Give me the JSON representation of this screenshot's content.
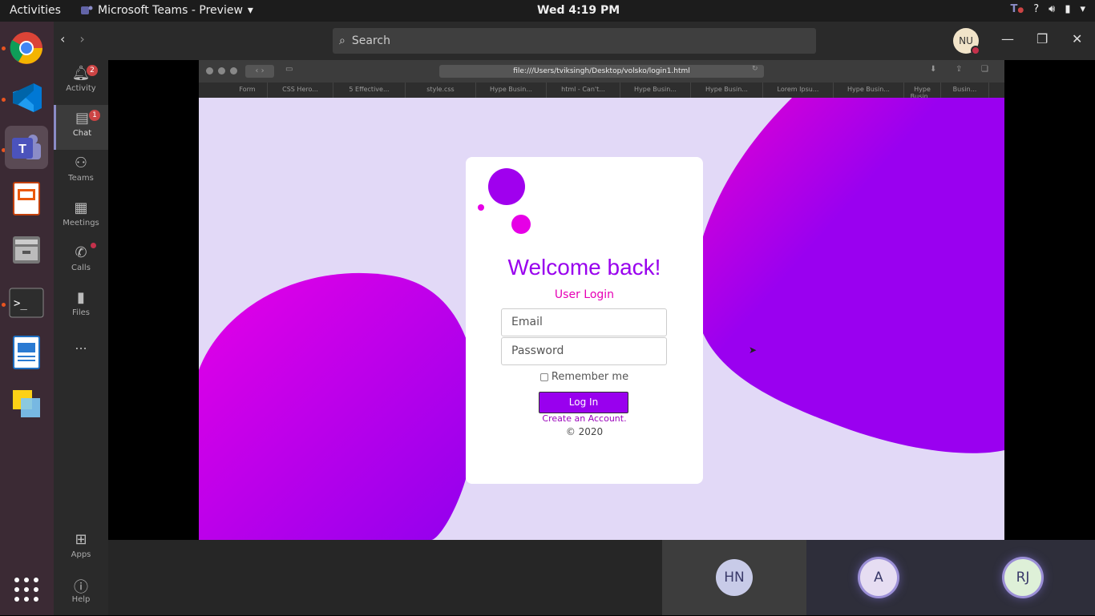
{
  "topbar": {
    "activities": "Activities",
    "app_name": "Microsoft Teams - Preview",
    "clock": "Wed  4:19 PM",
    "tray_icons": [
      "teams-notification-icon",
      "help-icon",
      "volume-icon",
      "battery-icon",
      "menu-arrow-icon"
    ]
  },
  "dock": {
    "items": [
      "chrome-icon",
      "vscode-icon",
      "teams-icon",
      "impress-icon",
      "files-icon",
      "terminal-icon",
      "writer-icon",
      "sticky-notes-icon",
      "app-grid-icon"
    ]
  },
  "rail": {
    "items": [
      {
        "label": "Activity",
        "badge": "2"
      },
      {
        "label": "Chat",
        "badge": "1"
      },
      {
        "label": "Teams"
      },
      {
        "label": "Meetings"
      },
      {
        "label": "Calls"
      },
      {
        "label": "Files"
      },
      {
        "label": "..."
      }
    ],
    "apps": "Apps",
    "help": "Help"
  },
  "header": {
    "search_placeholder": "Search",
    "avatar_initials": "NU"
  },
  "browser": {
    "url": "file:///Users/tviksingh/Desktop/volsko/login1.html",
    "tabs": [
      "Form",
      "CSS Hero...",
      "5 Effective...",
      "style.css",
      "Hype Busin...",
      "html - Can't...",
      "Hype Busin...",
      "Hype Busin...",
      "Lorem Ipsu...",
      "Hype Busin...",
      "Hype Busin...",
      "Busin..."
    ]
  },
  "login": {
    "title": "Welcome back!",
    "subtitle": "User Login",
    "email_placeholder": "Email",
    "password_placeholder": "Password",
    "remember": "Remember me",
    "button": "Log In",
    "create": "Create an Account.",
    "copyright": "© 2020",
    "colors": {
      "accent": "#9900ee",
      "pink": "#e600b5",
      "background": "#e2d9f7"
    }
  },
  "participants": [
    {
      "initials": "HN"
    },
    {
      "initials": "A"
    },
    {
      "initials": "RJ"
    }
  ]
}
